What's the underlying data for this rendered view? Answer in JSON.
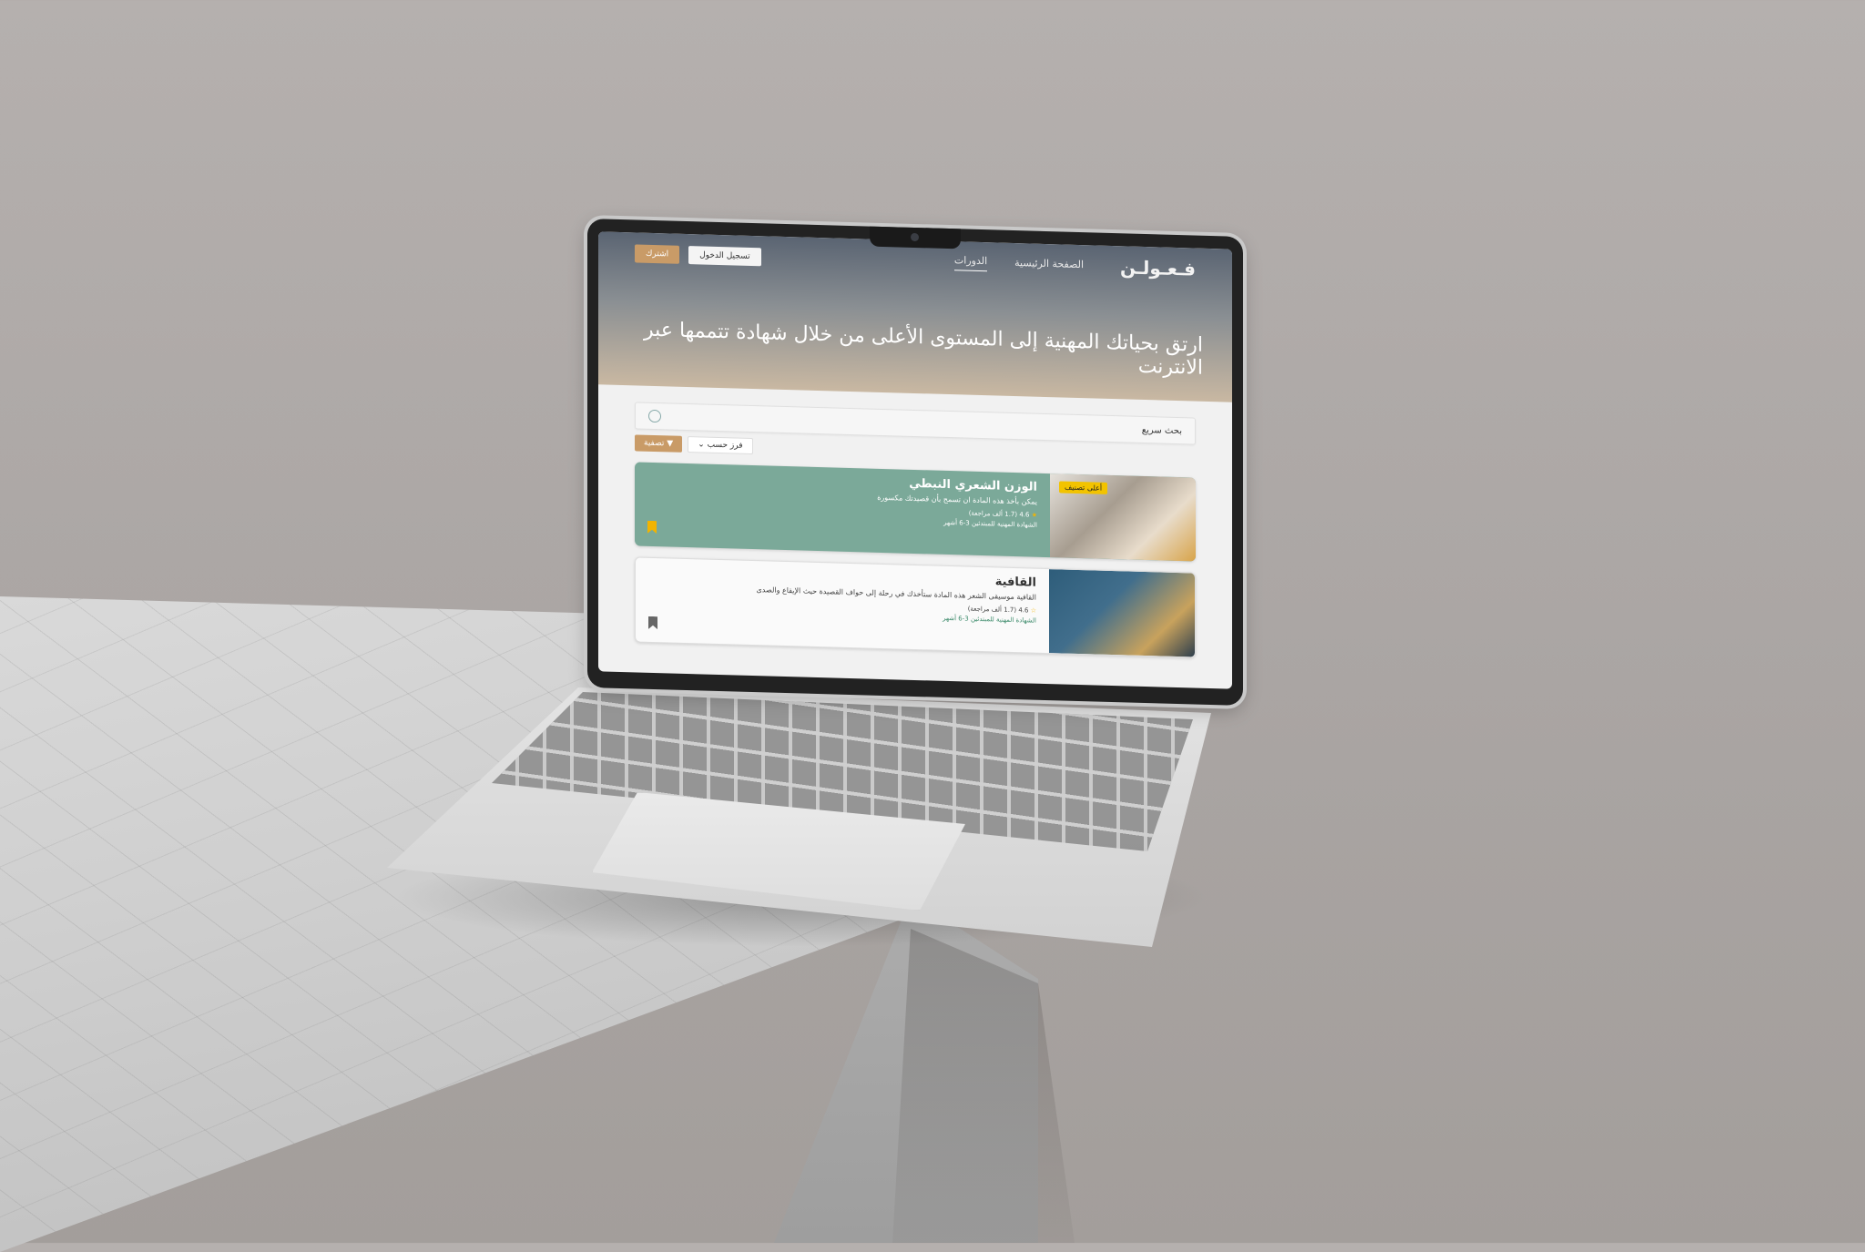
{
  "nav": {
    "logo": "فـعـولـن",
    "links": [
      "الصفحة الرئيسية",
      "الدورات"
    ],
    "login": "تسجيل الدخول",
    "subscribe": "اشترك"
  },
  "hero": {
    "title": "ارتق بحياتك المهنية إلى المستوى الأعلى من خلال شهادة تتممها عبر الانترنت"
  },
  "search": {
    "label": "بحث سريع",
    "placeholder": ""
  },
  "filters": {
    "sort": "فرز حسب",
    "filter": "تصفية"
  },
  "courses": [
    {
      "title": "الوزن الشعري النبطي",
      "desc": "يمكن بأخذ هذه المادة ان تسمح بأن قصيدتك مكسورة",
      "rating": "4.6",
      "reviews": "(1.7 ألف مراجعة)",
      "cert": "الشهادة المهنية للمبتدئين 3-6 أشهر",
      "badge": "أعلى تصنيف"
    },
    {
      "title": "القافية",
      "desc": "القافية موسيقى الشعر هذه المادة ستأخذك في رحلة إلى حواف القصيدة حيث الإيقاع والصدى",
      "rating": "4.6",
      "reviews": "(1.7 ألف مراجعة)",
      "cert": "الشهادة المهنية للمبتدئين 3-6 أشهر"
    }
  ],
  "colors": {
    "accent": "#c99b67",
    "card_green": "#7ba999",
    "badge": "#f2c300"
  }
}
